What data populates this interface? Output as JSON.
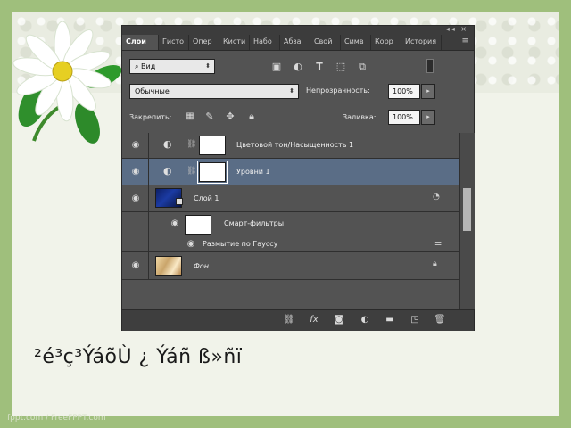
{
  "caption": "²é³ç³ÝáõÙ ¿ Ýáñ ß»ñï",
  "watermark": "fppt.com / FreeFPPT.com",
  "panel": {
    "window_controls": "◂◂ ×",
    "tabs": [
      "Слои",
      "Гисто",
      "Опер",
      "Кисти",
      "Набо",
      "Абза",
      "Свой",
      "Симв",
      "Корр",
      "История"
    ],
    "tab_menu_icon": "hamburger-menu-icon",
    "filter": {
      "value": "Вид",
      "icons": [
        "image-filter-icon",
        "adjustment-filter-icon",
        "type-filter-icon",
        "shape-filter-icon",
        "smart-object-filter-icon"
      ]
    },
    "blend_mode": "Обычные",
    "opacity_label": "Непрозрачность:",
    "opacity_value": "100%",
    "lock_label": "Закрепить:",
    "fill_label": "Заливка:",
    "fill_value": "100%",
    "layers": [
      {
        "name": "Цветовой тон/Насыщенность 1",
        "type": "adjustment",
        "selected": false
      },
      {
        "name": "Уровни 1",
        "type": "adjustment",
        "selected": true
      },
      {
        "name": "Слой 1",
        "type": "smart",
        "selected": false
      },
      {
        "name": "Смарт-фильтры",
        "type": "filter-group",
        "selected": false
      },
      {
        "name": "Размытие по Гауссу",
        "type": "filter",
        "selected": false
      },
      {
        "name": "Фон",
        "type": "background",
        "selected": false
      }
    ],
    "bottom_icons": [
      "link-icon",
      "fx-icon",
      "mask-icon",
      "adjustment-layer-icon",
      "group-folder-icon",
      "new-layer-icon",
      "trash-icon"
    ],
    "fx_label": "fx"
  },
  "colors": {
    "panel_bg": "#535353",
    "selected_row": "#5a6d86",
    "slide_border": "#9fbf7c"
  }
}
